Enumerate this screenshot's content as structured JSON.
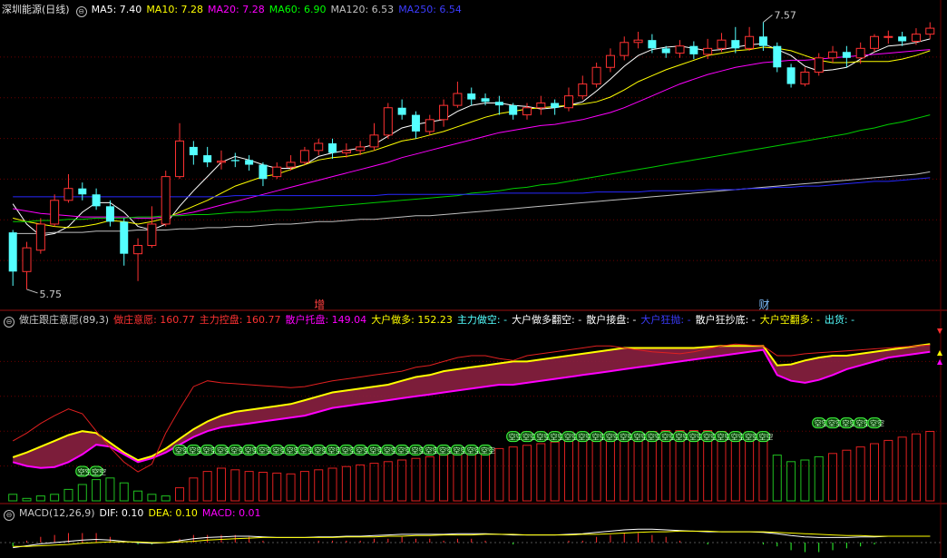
{
  "colors": {
    "up": "#ff3232",
    "down": "#54ffff",
    "grid": "#6b0000",
    "ma5": "#ffffff",
    "ma10": "#ffff00",
    "ma20": "#ff00ff",
    "ma60": "#00cc00",
    "ma120": "#c0c0c0",
    "ma250": "#2828ff"
  },
  "top_legend": {
    "title": "深圳能源(日线)",
    "ma5": "MA5: 7.40",
    "ma10": "MA10: 7.28",
    "ma20": "MA20: 7.28",
    "ma60": "MA60: 6.90",
    "ma120": "MA120: 6.53",
    "ma250": "MA250: 6.54"
  },
  "mid_legend": {
    "title": "做庄跟庄意愿(89,3)",
    "a": "做庄意愿: 160.77",
    "b": "主力控盘: 160.77",
    "c": "散户托盘: 149.04",
    "d": "大户做多: 152.23",
    "e": "主力做空: -",
    "f": "大户做多翻空: -",
    "g": "散户接盘: -",
    "h": "大户狂抛: -",
    "i": "散户狂抄底: -",
    "j": "大户空翻多: -",
    "k": "出货: -",
    "pill": "空空"
  },
  "bot_legend": {
    "title": "MACD(12,26,9)",
    "dif": "DIF: 0.10",
    "dea": "DEA: 0.10",
    "macd": "MACD: 0.01"
  },
  "chart_data": {
    "type": "candlestick",
    "high_label": "7.57",
    "low_label": "5.75",
    "markers": [
      {
        "label": "增",
        "index": 22,
        "color": "#ff4040"
      },
      {
        "label": "财",
        "index": 54,
        "color": "#7fbfff"
      }
    ],
    "candles": [
      [
        6.23,
        5.9,
        6.25,
        5.78
      ],
      [
        5.9,
        6.1,
        6.15,
        5.75
      ],
      [
        6.08,
        6.3,
        6.35,
        6.05
      ],
      [
        6.3,
        6.5,
        6.55,
        6.28
      ],
      [
        6.5,
        6.6,
        6.72,
        6.48
      ],
      [
        6.6,
        6.55,
        6.65,
        6.5
      ],
      [
        6.55,
        6.45,
        6.6,
        6.42
      ],
      [
        6.45,
        6.32,
        6.5,
        6.28
      ],
      [
        6.32,
        6.05,
        6.35,
        5.95
      ],
      [
        6.05,
        6.12,
        6.18,
        5.82
      ],
      [
        6.12,
        6.3,
        6.45,
        6.1
      ],
      [
        6.3,
        6.7,
        6.75,
        6.28
      ],
      [
        6.7,
        7.0,
        7.15,
        6.68
      ],
      [
        6.95,
        6.88,
        7.0,
        6.8
      ],
      [
        6.88,
        6.82,
        6.95,
        6.78
      ],
      [
        6.82,
        6.83,
        6.92,
        6.76
      ],
      [
        6.84,
        6.83,
        6.9,
        6.78
      ],
      [
        6.84,
        6.8,
        6.88,
        6.75
      ],
      [
        6.8,
        6.68,
        6.82,
        6.62
      ],
      [
        6.7,
        6.78,
        6.82,
        6.68
      ],
      [
        6.78,
        6.82,
        6.88,
        6.75
      ],
      [
        6.82,
        6.92,
        6.95,
        6.8
      ],
      [
        6.92,
        6.98,
        7.02,
        6.88
      ],
      [
        6.98,
        6.9,
        7.02,
        6.85
      ],
      [
        6.9,
        6.92,
        6.98,
        6.86
      ],
      [
        6.92,
        6.95,
        7.0,
        6.88
      ],
      [
        6.95,
        7.05,
        7.15,
        6.92
      ],
      [
        7.05,
        7.28,
        7.32,
        7.02
      ],
      [
        7.28,
        7.22,
        7.35,
        7.18
      ],
      [
        7.22,
        7.08,
        7.25,
        7.02
      ],
      [
        7.08,
        7.18,
        7.22,
        7.05
      ],
      [
        7.18,
        7.3,
        7.35,
        7.12
      ],
      [
        7.3,
        7.4,
        7.5,
        7.28
      ],
      [
        7.4,
        7.35,
        7.45,
        7.3
      ],
      [
        7.36,
        7.33,
        7.4,
        7.3
      ],
      [
        7.33,
        7.3,
        7.38,
        7.22
      ],
      [
        7.3,
        7.22,
        7.32,
        7.18
      ],
      [
        7.22,
        7.28,
        7.32,
        7.18
      ],
      [
        7.28,
        7.32,
        7.38,
        7.22
      ],
      [
        7.32,
        7.28,
        7.35,
        7.22
      ],
      [
        7.28,
        7.38,
        7.45,
        7.25
      ],
      [
        7.38,
        7.48,
        7.55,
        7.35
      ],
      [
        7.48,
        7.62,
        7.66,
        7.45
      ],
      [
        7.62,
        7.72,
        7.78,
        7.58
      ],
      [
        7.72,
        7.83,
        7.88,
        7.68
      ],
      [
        7.83,
        7.85,
        7.92,
        7.78
      ],
      [
        7.85,
        7.78,
        7.9,
        7.74
      ],
      [
        7.78,
        7.74,
        7.8,
        7.7
      ],
      [
        7.74,
        7.8,
        7.85,
        7.7
      ],
      [
        7.8,
        7.73,
        7.84,
        7.69
      ],
      [
        7.73,
        7.78,
        7.86,
        7.69
      ],
      [
        7.78,
        7.85,
        7.91,
        7.75
      ],
      [
        7.85,
        7.78,
        7.96,
        7.74
      ],
      [
        7.78,
        7.88,
        7.96,
        7.76
      ],
      [
        7.88,
        7.8,
        8.0,
        7.76
      ],
      [
        7.8,
        7.62,
        7.83,
        7.58
      ],
      [
        7.62,
        7.48,
        7.65,
        7.45
      ],
      [
        7.48,
        7.58,
        7.62,
        7.46
      ],
      [
        7.58,
        7.7,
        7.74,
        7.55
      ],
      [
        7.7,
        7.75,
        7.8,
        7.66
      ],
      [
        7.75,
        7.7,
        7.8,
        7.62
      ],
      [
        7.7,
        7.78,
        7.83,
        7.65
      ],
      [
        7.78,
        7.88,
        7.9,
        7.75
      ],
      [
        7.88,
        7.88,
        7.93,
        7.82
      ],
      [
        7.88,
        7.84,
        7.92,
        7.8
      ],
      [
        7.84,
        7.9,
        7.95,
        7.81
      ],
      [
        7.9,
        7.95,
        8.0,
        7.86
      ]
    ],
    "ma_lines": [
      {
        "name": "MA5",
        "color": "#ffffff",
        "values": [
          6.47,
          6.3,
          6.2,
          6.22,
          6.28,
          6.4,
          6.48,
          6.48,
          6.4,
          6.28,
          6.25,
          6.3,
          6.45,
          6.58,
          6.7,
          6.82,
          6.87,
          6.84,
          6.8,
          6.77,
          6.77,
          6.8,
          6.87,
          6.9,
          6.92,
          6.94,
          6.97,
          7.04,
          7.11,
          7.14,
          7.16,
          7.18,
          7.25,
          7.3,
          7.32,
          7.32,
          7.3,
          7.29,
          7.27,
          7.28,
          7.3,
          7.33,
          7.42,
          7.52,
          7.63,
          7.72,
          7.77,
          7.79,
          7.8,
          7.78,
          7.76,
          7.77,
          7.79,
          7.81,
          7.82,
          7.77,
          7.72,
          7.63,
          7.59,
          7.6,
          7.62,
          7.69,
          7.75,
          7.8,
          7.81,
          7.83,
          7.86
        ]
      },
      {
        "name": "MA10",
        "color": "#ffff00",
        "values": [
          6.35,
          6.32,
          6.3,
          6.28,
          6.27,
          6.28,
          6.3,
          6.33,
          6.32,
          6.3,
          6.32,
          6.35,
          6.4,
          6.45,
          6.5,
          6.56,
          6.62,
          6.66,
          6.7,
          6.72,
          6.76,
          6.8,
          6.84,
          6.86,
          6.87,
          6.89,
          6.92,
          6.96,
          7.0,
          7.02,
          7.05,
          7.08,
          7.12,
          7.16,
          7.2,
          7.23,
          7.25,
          7.27,
          7.28,
          7.29,
          7.3,
          7.31,
          7.33,
          7.37,
          7.43,
          7.5,
          7.55,
          7.6,
          7.64,
          7.68,
          7.72,
          7.74,
          7.76,
          7.77,
          7.79,
          7.78,
          7.76,
          7.72,
          7.68,
          7.66,
          7.66,
          7.67,
          7.67,
          7.67,
          7.69,
          7.72,
          7.76
        ]
      },
      {
        "name": "MA20",
        "color": "#ff00ff",
        "values": [
          6.43,
          6.41,
          6.39,
          6.38,
          6.37,
          6.36,
          6.36,
          6.36,
          6.36,
          6.35,
          6.35,
          6.36,
          6.38,
          6.4,
          6.43,
          6.46,
          6.49,
          6.52,
          6.55,
          6.58,
          6.61,
          6.64,
          6.67,
          6.7,
          6.73,
          6.76,
          6.79,
          6.82,
          6.86,
          6.89,
          6.92,
          6.95,
          6.98,
          7.01,
          7.04,
          7.07,
          7.09,
          7.11,
          7.13,
          7.14,
          7.16,
          7.18,
          7.21,
          7.24,
          7.28,
          7.33,
          7.38,
          7.43,
          7.48,
          7.52,
          7.56,
          7.59,
          7.62,
          7.64,
          7.66,
          7.67,
          7.68,
          7.68,
          7.69,
          7.7,
          7.71,
          7.72,
          7.73,
          7.74,
          7.75,
          7.76,
          7.77
        ]
      },
      {
        "name": "MA60",
        "color": "#00cc00",
        "values": [
          6.32,
          6.32,
          6.33,
          6.33,
          6.34,
          6.34,
          6.35,
          6.35,
          6.35,
          6.36,
          6.36,
          6.37,
          6.37,
          6.38,
          6.38,
          6.39,
          6.4,
          6.4,
          6.41,
          6.42,
          6.42,
          6.43,
          6.44,
          6.45,
          6.46,
          6.47,
          6.48,
          6.49,
          6.5,
          6.51,
          6.52,
          6.53,
          6.54,
          6.56,
          6.57,
          6.58,
          6.6,
          6.61,
          6.63,
          6.64,
          6.66,
          6.68,
          6.7,
          6.72,
          6.74,
          6.76,
          6.78,
          6.8,
          6.82,
          6.84,
          6.86,
          6.88,
          6.9,
          6.92,
          6.94,
          6.96,
          6.98,
          7.0,
          7.02,
          7.04,
          7.06,
          7.09,
          7.11,
          7.14,
          7.16,
          7.19,
          7.22
        ]
      },
      {
        "name": "MA120",
        "color": "#c0c0c0",
        "values": [
          6.22,
          6.22,
          6.22,
          6.23,
          6.23,
          6.23,
          6.24,
          6.24,
          6.24,
          6.25,
          6.25,
          6.25,
          6.26,
          6.26,
          6.27,
          6.27,
          6.28,
          6.28,
          6.29,
          6.3,
          6.3,
          6.31,
          6.32,
          6.32,
          6.33,
          6.34,
          6.34,
          6.35,
          6.36,
          6.37,
          6.37,
          6.38,
          6.39,
          6.4,
          6.41,
          6.42,
          6.43,
          6.44,
          6.45,
          6.46,
          6.47,
          6.48,
          6.49,
          6.5,
          6.51,
          6.52,
          6.53,
          6.54,
          6.55,
          6.56,
          6.57,
          6.58,
          6.59,
          6.6,
          6.61,
          6.62,
          6.63,
          6.64,
          6.65,
          6.66,
          6.67,
          6.68,
          6.69,
          6.7,
          6.71,
          6.72,
          6.74
        ]
      },
      {
        "name": "MA250",
        "color": "#2828ff",
        "values": [
          6.53,
          6.53,
          6.53,
          6.53,
          6.53,
          6.53,
          6.53,
          6.53,
          6.53,
          6.53,
          6.53,
          6.53,
          6.53,
          6.53,
          6.53,
          6.53,
          6.54,
          6.54,
          6.54,
          6.54,
          6.54,
          6.54,
          6.54,
          6.54,
          6.54,
          6.54,
          6.54,
          6.55,
          6.55,
          6.55,
          6.55,
          6.55,
          6.55,
          6.55,
          6.55,
          6.56,
          6.56,
          6.56,
          6.56,
          6.56,
          6.56,
          6.56,
          6.57,
          6.57,
          6.57,
          6.57,
          6.58,
          6.58,
          6.58,
          6.58,
          6.59,
          6.59,
          6.59,
          6.6,
          6.6,
          6.61,
          6.61,
          6.62,
          6.62,
          6.63,
          6.64,
          6.65,
          6.66,
          6.66,
          6.67,
          6.68,
          6.69
        ]
      }
    ],
    "ylim": [
      5.65,
      8.05
    ],
    "indicator": {
      "bars": [
        8,
        3,
        6,
        8,
        14,
        20,
        26,
        28,
        22,
        12,
        8,
        6,
        16,
        28,
        36,
        40,
        38,
        36,
        35,
        34,
        33,
        36,
        38,
        40,
        42,
        44,
        46,
        48,
        50,
        52,
        54,
        56,
        58,
        60,
        62,
        64,
        66,
        68,
        70,
        72,
        74,
        76,
        78,
        80,
        82,
        84,
        85,
        86,
        86,
        86,
        86,
        85,
        84,
        83,
        82,
        56,
        48,
        50,
        54,
        58,
        62,
        66,
        70,
        74,
        78,
        82,
        85
      ],
      "red_line": [
        62,
        70,
        80,
        88,
        95,
        90,
        72,
        55,
        40,
        30,
        38,
        70,
        95,
        118,
        124,
        122,
        121,
        120,
        119,
        118,
        117,
        118,
        121,
        124,
        126,
        128,
        130,
        132,
        134,
        138,
        140,
        144,
        148,
        150,
        150,
        147,
        145,
        150,
        152,
        154,
        156,
        158,
        160,
        160,
        158,
        156,
        154,
        153,
        152,
        154,
        157,
        160,
        162,
        161,
        160,
        150,
        150,
        152,
        153,
        154,
        155,
        156,
        157,
        158,
        159,
        160,
        161
      ],
      "band_top": [
        45,
        50,
        56,
        62,
        68,
        72,
        70,
        60,
        50,
        42,
        46,
        54,
        64,
        74,
        82,
        88,
        92,
        94,
        96,
        98,
        100,
        104,
        108,
        112,
        114,
        116,
        118,
        120,
        124,
        128,
        130,
        134,
        136,
        138,
        140,
        142,
        144,
        144,
        146,
        148,
        150,
        152,
        154,
        156,
        158,
        158,
        158,
        158,
        158,
        158,
        159,
        160,
        160,
        160,
        160,
        140,
        141,
        145,
        148,
        150,
        150,
        152,
        154,
        156,
        158,
        160,
        162
      ],
      "band_bot": [
        40,
        36,
        34,
        35,
        40,
        48,
        58,
        56,
        48,
        40,
        44,
        50,
        58,
        66,
        72,
        76,
        78,
        80,
        82,
        84,
        86,
        88,
        92,
        96,
        98,
        100,
        102,
        104,
        106,
        108,
        110,
        112,
        114,
        116,
        118,
        120,
        120,
        122,
        124,
        126,
        128,
        130,
        132,
        134,
        136,
        138,
        140,
        142,
        144,
        146,
        148,
        150,
        152,
        154,
        156,
        130,
        124,
        122,
        125,
        130,
        136,
        140,
        144,
        148,
        150,
        152,
        154
      ],
      "ymin": 0,
      "ymax": 180
    },
    "macd": {
      "dif": [
        -0.08,
        -0.05,
        -0.02,
        0.0,
        0.02,
        0.04,
        0.05,
        0.04,
        0.02,
        0.0,
        -0.01,
        0.0,
        0.03,
        0.06,
        0.08,
        0.09,
        0.1,
        0.1,
        0.09,
        0.08,
        0.08,
        0.08,
        0.09,
        0.09,
        0.1,
        0.1,
        0.11,
        0.12,
        0.13,
        0.13,
        0.13,
        0.13,
        0.14,
        0.14,
        0.14,
        0.13,
        0.12,
        0.12,
        0.12,
        0.12,
        0.13,
        0.14,
        0.16,
        0.18,
        0.2,
        0.21,
        0.21,
        0.2,
        0.19,
        0.18,
        0.17,
        0.17,
        0.17,
        0.17,
        0.16,
        0.14,
        0.11,
        0.09,
        0.08,
        0.08,
        0.08,
        0.09,
        0.09,
        0.1,
        0.1,
        0.1,
        0.1
      ],
      "dea": [
        -0.06,
        -0.06,
        -0.05,
        -0.04,
        -0.03,
        -0.01,
        0.0,
        0.01,
        0.01,
        0.01,
        0.0,
        0.0,
        0.01,
        0.02,
        0.04,
        0.05,
        0.06,
        0.07,
        0.08,
        0.08,
        0.08,
        0.08,
        0.08,
        0.08,
        0.09,
        0.09,
        0.09,
        0.1,
        0.1,
        0.11,
        0.11,
        0.12,
        0.12,
        0.12,
        0.13,
        0.13,
        0.13,
        0.12,
        0.12,
        0.12,
        0.12,
        0.13,
        0.13,
        0.14,
        0.15,
        0.16,
        0.17,
        0.17,
        0.18,
        0.18,
        0.18,
        0.17,
        0.17,
        0.17,
        0.17,
        0.16,
        0.15,
        0.14,
        0.13,
        0.12,
        0.11,
        0.11,
        0.1,
        0.1,
        0.1,
        0.1,
        0.1
      ]
    }
  }
}
